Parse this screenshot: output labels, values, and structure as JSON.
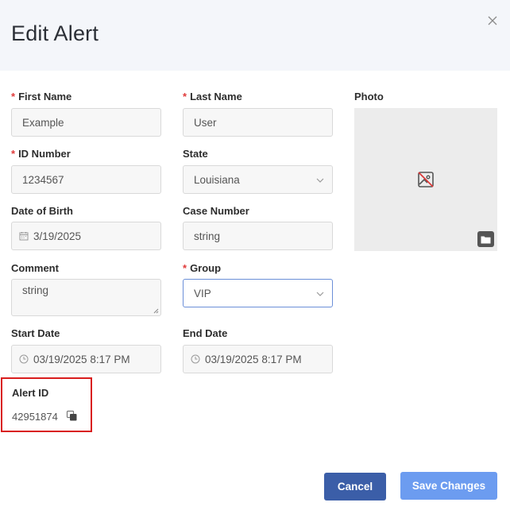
{
  "dialog": {
    "title": "Edit Alert",
    "required_marker": "*"
  },
  "fields": {
    "first_name": {
      "label": "First Name",
      "value": "Example"
    },
    "last_name": {
      "label": "Last Name",
      "value": "User"
    },
    "id_number": {
      "label": "ID Number",
      "value": "1234567"
    },
    "state": {
      "label": "State",
      "value": "Louisiana"
    },
    "dob": {
      "label": "Date of Birth",
      "value": "3/19/2025"
    },
    "case_number": {
      "label": "Case Number",
      "value": "string"
    },
    "comment": {
      "label": "Comment",
      "value": "string"
    },
    "group": {
      "label": "Group",
      "value": "VIP"
    },
    "start_date": {
      "label": "Start Date",
      "value": "03/19/2025 8:17 PM"
    },
    "end_date": {
      "label": "End Date",
      "value": "03/19/2025 8:17 PM"
    }
  },
  "photo": {
    "label": "Photo"
  },
  "alert": {
    "label": "Alert ID",
    "value": "42951874"
  },
  "actions": {
    "cancel_label": "Cancel",
    "save_label": "Save Changes"
  },
  "colors": {
    "primary": "#3b5ea8",
    "primary_light": "#6c9cf0",
    "required": "#e03a3a",
    "highlight_border": "#d91d1d"
  }
}
